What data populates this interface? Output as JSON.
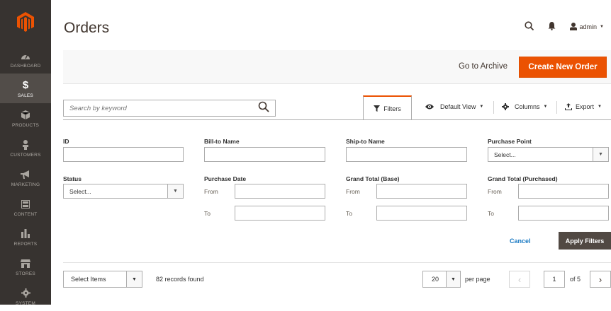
{
  "sidebar": {
    "items": [
      {
        "label": "Dashboard",
        "icon": "gauge-icon",
        "active": false
      },
      {
        "label": "Sales",
        "icon": "dollar-icon",
        "active": true
      },
      {
        "label": "Products",
        "icon": "cube-icon",
        "active": false
      },
      {
        "label": "Customers",
        "icon": "person-icon",
        "active": false
      },
      {
        "label": "Marketing",
        "icon": "megaphone-icon",
        "active": false
      },
      {
        "label": "Content",
        "icon": "layout-icon",
        "active": false
      },
      {
        "label": "Reports",
        "icon": "bar-chart-icon",
        "active": false
      },
      {
        "label": "Stores",
        "icon": "storefront-icon",
        "active": false
      },
      {
        "label": "System",
        "icon": "gear-icon",
        "active": false
      }
    ]
  },
  "header": {
    "title": "Orders",
    "user": "admin"
  },
  "actions": {
    "archive_label": "Go to Archive",
    "create_label": "Create New Order"
  },
  "search": {
    "placeholder": "Search by keyword"
  },
  "toolbar": {
    "filters_label": "Filters",
    "view_label": "Default View",
    "columns_label": "Columns",
    "export_label": "Export"
  },
  "filters": {
    "id_label": "ID",
    "bill_to_label": "Bill-to Name",
    "ship_to_label": "Ship-to Name",
    "purchase_point_label": "Purchase Point",
    "purchase_point_value": "Select...",
    "status_label": "Status",
    "status_value": "Select...",
    "purchase_date_label": "Purchase Date",
    "grand_total_base_label": "Grand Total (Base)",
    "grand_total_purchased_label": "Grand Total (Purchased)",
    "from_label": "From",
    "to_label": "To",
    "cancel_label": "Cancel",
    "apply_label": "Apply Filters"
  },
  "grid": {
    "mass_action": "Select Items",
    "records": "82 records found",
    "page_size": "20",
    "per_page_label": "per page",
    "current_page": "1",
    "of_pages": "of 5"
  },
  "colors": {
    "accent": "#eb5202",
    "sidebar_bg": "#373330",
    "link": "#1979c3",
    "apply_bg": "#514943"
  }
}
